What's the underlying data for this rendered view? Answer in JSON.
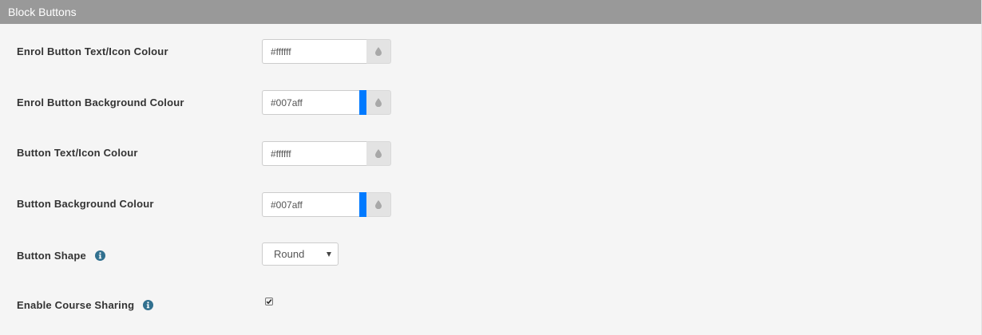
{
  "panel": {
    "title": "Block Buttons"
  },
  "fields": [
    {
      "label": "Enrol Button Text/Icon Colour",
      "value": "#ffffff",
      "swatch": "#ffffff"
    },
    {
      "label": "Enrol Button Background Colour",
      "value": "#007aff",
      "swatch": "#007aff"
    },
    {
      "label": "Button Text/Icon Colour",
      "value": "#ffffff",
      "swatch": "#ffffff"
    },
    {
      "label": "Button Background Colour",
      "value": "#007aff",
      "swatch": "#007aff"
    }
  ],
  "button_shape": {
    "label": "Button Shape",
    "selected": "Round",
    "info_icon": "info-circle-icon"
  },
  "course_sharing": {
    "label": "Enable Course Sharing",
    "checked": true,
    "info_icon": "info-circle-icon"
  },
  "icons": {
    "picker": "drop-icon"
  },
  "colors": {
    "header_bg": "#999999",
    "panel_bg": "#f5f5f5",
    "info_icon": "#31708f",
    "accent_blue": "#007aff"
  }
}
